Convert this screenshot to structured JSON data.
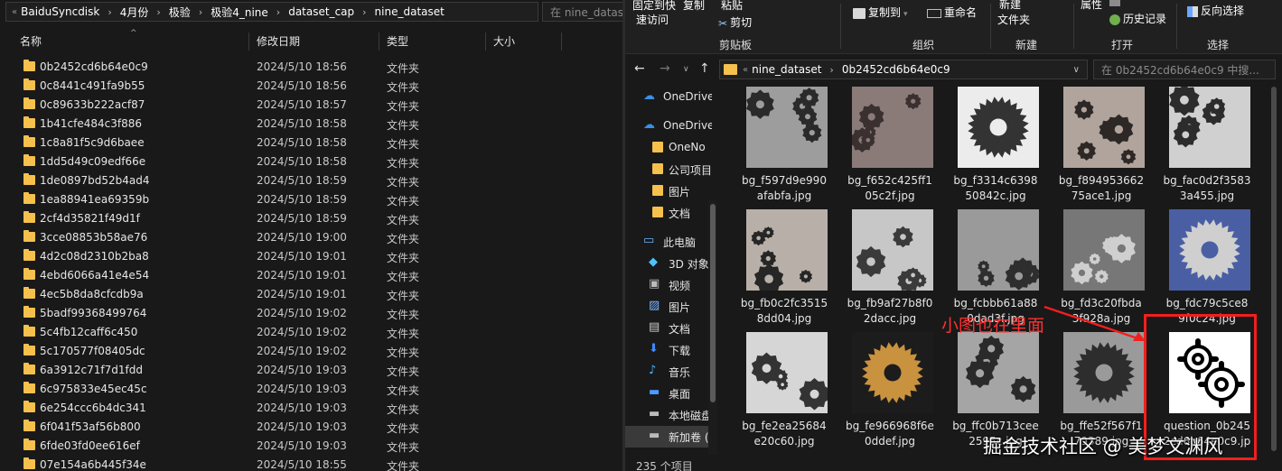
{
  "left": {
    "breadcrumb": [
      "BaiduSyncdisk",
      "4月份",
      "极验",
      "极验4_nine",
      "dataset_cap",
      "nine_dataset"
    ],
    "search_placeholder": "在 nine_datase",
    "columns": {
      "name": "名称",
      "date": "修改日期",
      "type": "类型",
      "size": "大小"
    },
    "rows": [
      {
        "name": "0b2452cd6b64e0c9",
        "date": "2024/5/10 18:56",
        "type": "文件夹"
      },
      {
        "name": "0c8441c491fa9b55",
        "date": "2024/5/10 18:56",
        "type": "文件夹"
      },
      {
        "name": "0c89633b222acf87",
        "date": "2024/5/10 18:57",
        "type": "文件夹"
      },
      {
        "name": "1b41cfe484c3f886",
        "date": "2024/5/10 18:58",
        "type": "文件夹"
      },
      {
        "name": "1c8a81f5c9d6baee",
        "date": "2024/5/10 18:58",
        "type": "文件夹"
      },
      {
        "name": "1dd5d49c09edf66e",
        "date": "2024/5/10 18:58",
        "type": "文件夹"
      },
      {
        "name": "1de0897bd52b4ad4",
        "date": "2024/5/10 18:59",
        "type": "文件夹"
      },
      {
        "name": "1ea88941ea69359b",
        "date": "2024/5/10 18:59",
        "type": "文件夹"
      },
      {
        "name": "2cf4d35821f49d1f",
        "date": "2024/5/10 18:59",
        "type": "文件夹"
      },
      {
        "name": "3cce08853b58ae76",
        "date": "2024/5/10 19:00",
        "type": "文件夹"
      },
      {
        "name": "4d2c08d2310b2ba8",
        "date": "2024/5/10 19:01",
        "type": "文件夹"
      },
      {
        "name": "4ebd6066a41e4e54",
        "date": "2024/5/10 19:01",
        "type": "文件夹"
      },
      {
        "name": "4ec5b8da8cfcdb9a",
        "date": "2024/5/10 19:01",
        "type": "文件夹"
      },
      {
        "name": "5badf99368499764",
        "date": "2024/5/10 19:02",
        "type": "文件夹"
      },
      {
        "name": "5c4fb12caff6c450",
        "date": "2024/5/10 19:02",
        "type": "文件夹"
      },
      {
        "name": "5c170577f08405dc",
        "date": "2024/5/10 19:02",
        "type": "文件夹"
      },
      {
        "name": "6a3912c71f7d1fdd",
        "date": "2024/5/10 19:03",
        "type": "文件夹"
      },
      {
        "name": "6c975833e45ec45c",
        "date": "2024/5/10 19:03",
        "type": "文件夹"
      },
      {
        "name": "6e254ccc6b4dc341",
        "date": "2024/5/10 19:03",
        "type": "文件夹"
      },
      {
        "name": "6f041f53af56b800",
        "date": "2024/5/10 19:03",
        "type": "文件夹"
      },
      {
        "name": "6fde03fd0ee616ef",
        "date": "2024/5/10 19:03",
        "type": "文件夹"
      },
      {
        "name": "07e154a6b445f34e",
        "date": "2024/5/10 18:55",
        "type": "文件夹"
      }
    ]
  },
  "right": {
    "ribbon": {
      "pin_label_1": "固定到快",
      "pin_label_2": "速访问",
      "copy": "复制",
      "paste": "粘贴",
      "cut": "剪切",
      "copy_to": "复制到",
      "rename": "重命名",
      "new_1": "新建",
      "new_2": "文件夹",
      "properties": "属性",
      "history": "历史记录",
      "invert_select": "反向选择",
      "group_clipboard": "剪贴板",
      "group_organize": "组织",
      "group_new": "新建",
      "group_open": "打开",
      "group_select": "选择"
    },
    "breadcrumb": [
      "nine_dataset",
      "0b2452cd6b64e0c9"
    ],
    "search_placeholder": "在 0b2452cd6b64e0c9 中搜...",
    "nav": [
      {
        "label": "OneDrive",
        "icon": "cloud-icon"
      },
      {
        "label": "OneDrive",
        "icon": "cloud-icon"
      },
      {
        "label": "OneNo",
        "icon": "folder-icon"
      },
      {
        "label": "公司项目",
        "icon": "folder-icon"
      },
      {
        "label": "图片",
        "icon": "folder-icon"
      },
      {
        "label": "文档",
        "icon": "folder-icon"
      },
      {
        "label": "此电脑",
        "icon": "computer-icon"
      },
      {
        "label": "3D 对象",
        "icon": "cube-icon"
      },
      {
        "label": "视频",
        "icon": "video-icon"
      },
      {
        "label": "图片",
        "icon": "picture-icon"
      },
      {
        "label": "文档",
        "icon": "document-icon"
      },
      {
        "label": "下载",
        "icon": "download-icon"
      },
      {
        "label": "音乐",
        "icon": "music-icon"
      },
      {
        "label": "桌面",
        "icon": "desktop-icon"
      },
      {
        "label": "本地磁盘",
        "icon": "drive-icon"
      },
      {
        "label": "新加卷 (",
        "icon": "drive-icon"
      }
    ],
    "files": [
      {
        "line1": "bg_f597d9e990",
        "line2": "afabfa.jpg"
      },
      {
        "line1": "bg_f652c425ff1",
        "line2": "05c2f.jpg"
      },
      {
        "line1": "bg_f3314c6398",
        "line2": "50842c.jpg"
      },
      {
        "line1": "bg_f894953662",
        "line2": "75ace1.jpg"
      },
      {
        "line1": "bg_fac0d2f3583",
        "line2": "3a455.jpg"
      },
      {
        "line1": "bg_fb0c2fc3515",
        "line2": "8dd04.jpg"
      },
      {
        "line1": "bg_fb9af27b8f0",
        "line2": "2dacc.jpg"
      },
      {
        "line1": "bg_fcbbb61a88",
        "line2": "0dad3f.jpg"
      },
      {
        "line1": "bg_fd3c20fbda",
        "line2": "3f928a.jpg"
      },
      {
        "line1": "bg_fdc79c5ce8",
        "line2": "9f0c24.jpg"
      },
      {
        "line1": "bg_fe2ea25684",
        "line2": "e20c60.jpg"
      },
      {
        "line1": "bg_fe966968f6e",
        "line2": "0ddef.jpg"
      },
      {
        "line1": "bg_ffc0b713cee",
        "line2": "2595c.jpg"
      },
      {
        "line1": "bg_ffe52f567f1",
        "line2": "79389.jpg"
      },
      {
        "line1": "question_0b245",
        "line2": "2cd6b64e0c9.jp"
      }
    ],
    "status": "235 个项目"
  },
  "annotation": "小图也在里面",
  "watermark": "掘金技术社区 @ 美梦文渊风",
  "colors": {
    "folder": "#f6c04d",
    "annotation": "#f21f1f",
    "background": "#191919"
  }
}
